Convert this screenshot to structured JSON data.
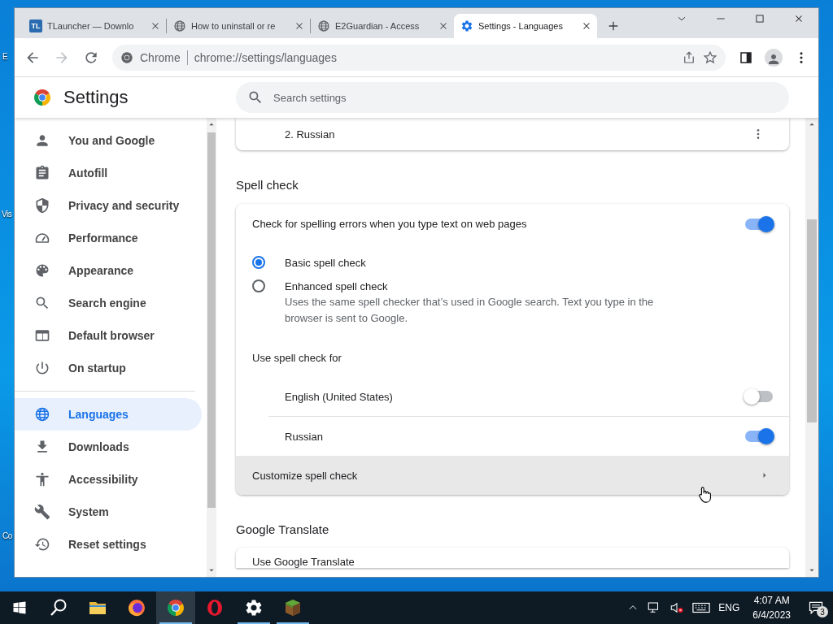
{
  "desktop": {
    "icon_labels": [
      "E",
      "Vis",
      "Co"
    ]
  },
  "window": {
    "tabs": [
      {
        "title": "TLauncher — Downlo",
        "kind": "letters",
        "icon_text": "TL",
        "selected": false
      },
      {
        "title": "How to uninstall or re",
        "kind": "globe",
        "selected": false
      },
      {
        "title": "E2Guardian - Access",
        "kind": "globe",
        "selected": false
      },
      {
        "title": "Settings - Languages",
        "kind": "gear",
        "selected": true
      }
    ],
    "address_bar": {
      "site_label": "Chrome",
      "url": "chrome://settings/languages"
    }
  },
  "settings_header": {
    "title": "Settings",
    "search": {
      "placeholder": "Search settings"
    }
  },
  "sidebar": {
    "items": [
      {
        "label": "You and Google",
        "kind": "person",
        "selected": false,
        "divider_before": false
      },
      {
        "label": "Autofill",
        "kind": "clipboard",
        "selected": false,
        "divider_before": false
      },
      {
        "label": "Privacy and security",
        "kind": "shield",
        "selected": false,
        "divider_before": false
      },
      {
        "label": "Performance",
        "kind": "gauge",
        "selected": false,
        "divider_before": false
      },
      {
        "label": "Appearance",
        "kind": "palette",
        "selected": false,
        "divider_before": false
      },
      {
        "label": "Search engine",
        "kind": "search",
        "selected": false,
        "divider_before": false
      },
      {
        "label": "Default browser",
        "kind": "browser",
        "selected": false,
        "divider_before": false
      },
      {
        "label": "On startup",
        "kind": "power",
        "selected": false,
        "divider_before": false
      },
      {
        "label": "Languages",
        "kind": "globe",
        "selected": true,
        "divider_before": true
      },
      {
        "label": "Downloads",
        "kind": "download",
        "selected": false,
        "divider_before": false
      },
      {
        "label": "Accessibility",
        "kind": "accessibility",
        "selected": false,
        "divider_before": false
      },
      {
        "label": "System",
        "kind": "wrench",
        "selected": false,
        "divider_before": false
      },
      {
        "label": "Reset settings",
        "kind": "history",
        "selected": false,
        "divider_before": false
      }
    ]
  },
  "content": {
    "language_row": {
      "label": "2. Russian"
    },
    "spell_check": {
      "heading": "Spell check",
      "toggle": {
        "label": "Check for spelling errors when you type text on web pages",
        "on": true
      },
      "options": [
        {
          "label": "Basic spell check",
          "selected": true
        },
        {
          "label": "Enhanced spell check",
          "description": "Uses the same spell checker that’s used in Google search. Text you type in the browser is sent to Google.",
          "selected": false
        }
      ],
      "languages_heading": "Use spell check for",
      "languages": [
        {
          "label": "English (United States)",
          "on": false
        },
        {
          "label": "Russian",
          "on": true
        }
      ],
      "customize": {
        "label": "Customize spell check",
        "hovered": true
      }
    },
    "translate": {
      "heading": "Google Translate",
      "first_row": "Use Google Translate"
    }
  },
  "taskbar": {
    "apps": [
      {
        "kind": "start",
        "running": false,
        "selected": false
      },
      {
        "kind": "search",
        "running": false,
        "selected": false
      },
      {
        "kind": "folder",
        "running": false,
        "selected": false
      },
      {
        "kind": "fox",
        "running": false,
        "selected": false
      },
      {
        "kind": "ring",
        "running": true,
        "selected": true
      },
      {
        "kind": "o",
        "running": false,
        "selected": false
      },
      {
        "kind": "gear",
        "running": true,
        "selected": false
      },
      {
        "kind": "block",
        "running": true,
        "selected": false
      }
    ],
    "tray": {
      "language": "ENG",
      "time": "4:07 AM",
      "date": "6/4/2023",
      "notifications": "3"
    }
  }
}
